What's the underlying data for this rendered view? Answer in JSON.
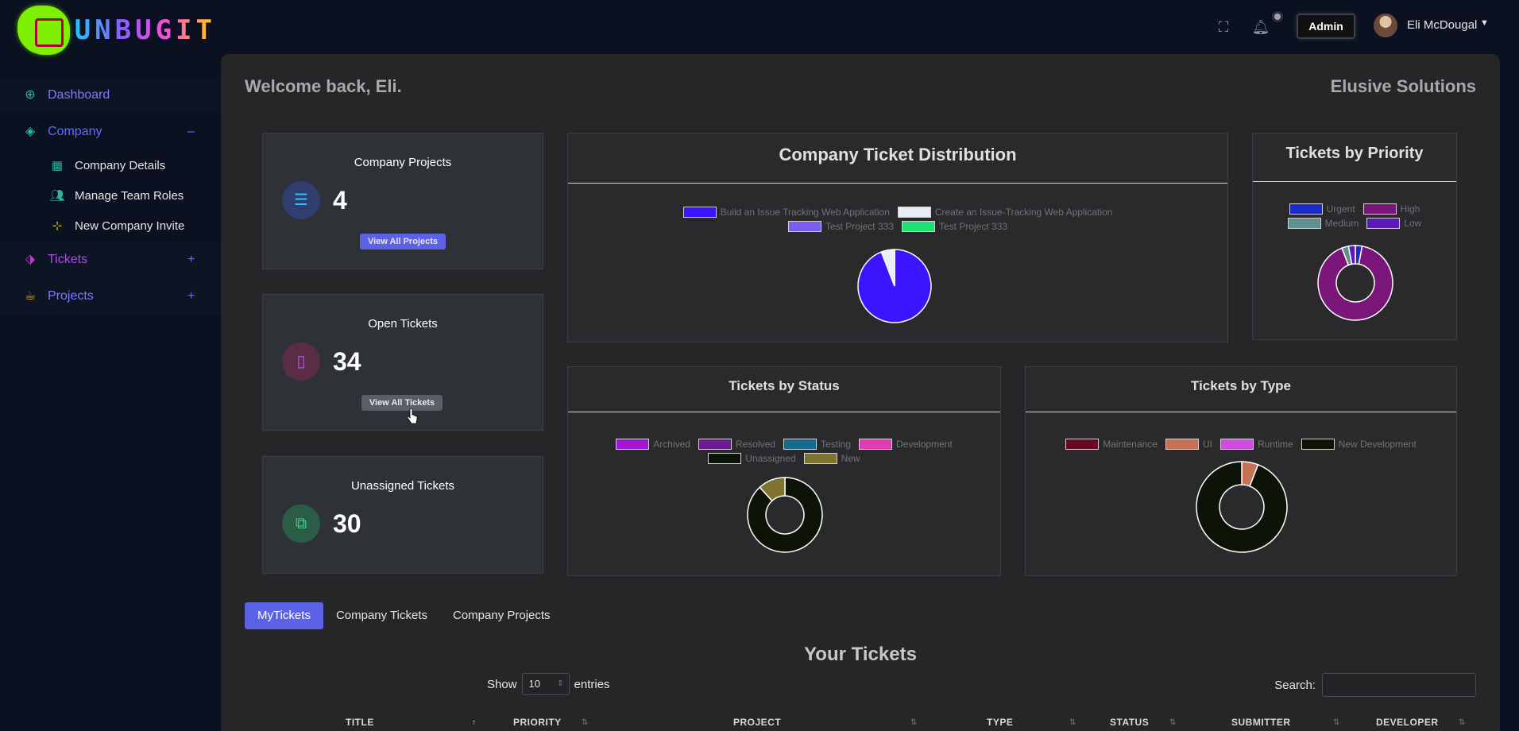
{
  "brand": {
    "logo_text": "UNBUGIT"
  },
  "topbar": {
    "icons": [
      "fullscreen-icon",
      "bell-icon"
    ],
    "role_badge": "Admin",
    "user_name": "Eli McDougal"
  },
  "sidebar": {
    "items": [
      {
        "label": "Dashboard",
        "icon": "crosshair-icon",
        "color": "#7b7bff"
      },
      {
        "label": "Company",
        "icon": "layers-icon",
        "toggle": "–",
        "color": "#5f6cff"
      },
      {
        "label": "Tickets",
        "icon": "tag-icon",
        "toggle": "+",
        "color": "#a64fe0"
      },
      {
        "label": "Projects",
        "icon": "coffee-icon",
        "toggle": "+",
        "color": "#7b7bff"
      }
    ],
    "company_sub": [
      {
        "label": "Company Details",
        "icon": "layout-icon"
      },
      {
        "label": "Manage Team Roles",
        "icon": "users-icon"
      },
      {
        "label": "New Company Invite",
        "icon": "user-plus-icon"
      }
    ]
  },
  "header": {
    "welcome": "Welcome back, Eli.",
    "company": "Elusive Solutions"
  },
  "stats": [
    {
      "title": "Company Projects",
      "value": "4",
      "button": "View All Projects",
      "icon": "server-icon",
      "circle_color": "#2f3e6e",
      "icon_color": "#2ec3ff",
      "button_color": "#5b62e6"
    },
    {
      "title": "Open Tickets",
      "value": "34",
      "button": "View All Tickets",
      "icon": "phone-icon",
      "circle_color": "#5a2c48",
      "icon_color": "#b35bd6",
      "button_color": "#5b5e66"
    },
    {
      "title": "Unassigned Tickets",
      "value": "30",
      "button": "",
      "icon": "copy-icon",
      "circle_color": "#2a5c46",
      "icon_color": "#3ed38a",
      "button_color": ""
    }
  ],
  "charts": {
    "distribution": {
      "title": "Company Ticket Distribution",
      "legend": [
        {
          "label": "Build an Issue Tracking Web Application",
          "color": "#3c14ff"
        },
        {
          "label": "Create an Issue-Tracking Web Application",
          "color": "#e8eef5"
        },
        {
          "label": "Test Project 333",
          "color": "#7a5cf0"
        },
        {
          "label": "Test Project 333",
          "color": "#1ee070"
        }
      ]
    },
    "priority": {
      "title": "Tickets by Priority",
      "legend": [
        {
          "label": "Urgent",
          "color": "#1c2ccc"
        },
        {
          "label": "High",
          "color": "#7a157a"
        },
        {
          "label": "Medium",
          "color": "#5f8f90"
        },
        {
          "label": "Low",
          "color": "#5a19b8"
        }
      ]
    },
    "status": {
      "title": "Tickets by Status",
      "legend": [
        {
          "label": "Archived",
          "color": "#a313d6"
        },
        {
          "label": "Resolved",
          "color": "#6c1a90"
        },
        {
          "label": "Testing",
          "color": "#146c8c"
        },
        {
          "label": "Development",
          "color": "#e03cb0"
        },
        {
          "label": "Unassigned",
          "color": "#0c1408"
        },
        {
          "label": "New",
          "color": "#7e7430"
        }
      ]
    },
    "type": {
      "title": "Tickets by Type",
      "legend": [
        {
          "label": "Maintenance",
          "color": "#6a0a22"
        },
        {
          "label": "UI",
          "color": "#c77256"
        },
        {
          "label": "Runtime",
          "color": "#d04ce0"
        },
        {
          "label": "New Development",
          "color": "#0c1408"
        }
      ]
    }
  },
  "chart_data": [
    {
      "type": "pie",
      "title": "Company Ticket Distribution",
      "categories": [
        "Build an Issue Tracking Web Application",
        "Create an Issue-Tracking Web Application",
        "Test Project 333",
        "Test Project 333"
      ],
      "values": [
        32,
        2,
        0,
        0
      ]
    },
    {
      "type": "pie",
      "title": "Tickets by Priority",
      "donut": true,
      "categories": [
        "Urgent",
        "High",
        "Medium",
        "Low"
      ],
      "values": [
        1,
        31,
        1,
        1
      ]
    },
    {
      "type": "pie",
      "title": "Tickets by Status",
      "donut": true,
      "categories": [
        "Archived",
        "Resolved",
        "Testing",
        "Development",
        "Unassigned",
        "New"
      ],
      "values": [
        0,
        0,
        0,
        0,
        30,
        4
      ]
    },
    {
      "type": "pie",
      "title": "Tickets by Type",
      "donut": true,
      "categories": [
        "Maintenance",
        "UI",
        "Runtime",
        "New Development"
      ],
      "values": [
        0,
        2,
        0,
        32
      ]
    }
  ],
  "tabs": [
    {
      "label": "MyTickets",
      "active": true
    },
    {
      "label": "Company Tickets",
      "active": false
    },
    {
      "label": "Company Projects",
      "active": false
    }
  ],
  "table": {
    "heading": "Your Tickets",
    "show_label": "Show",
    "show_value": "10",
    "entries_label": "entries",
    "search_label": "Search:",
    "search_value": "",
    "columns": [
      "TITLE",
      "PRIORITY",
      "PROJECT",
      "TYPE",
      "STATUS",
      "SUBMITTER",
      "DEVELOPER"
    ]
  }
}
